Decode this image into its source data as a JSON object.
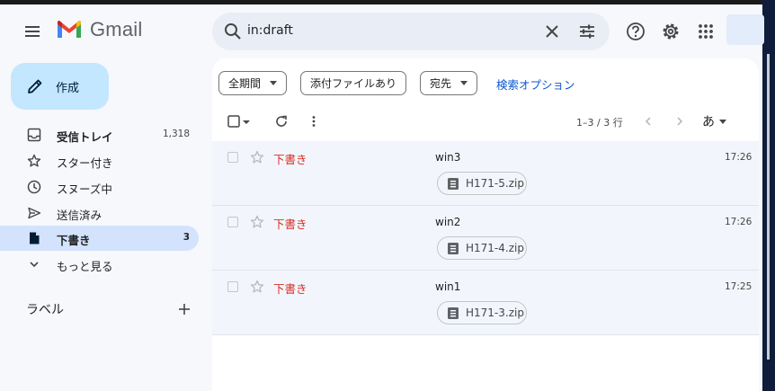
{
  "app": {
    "name": "Gmail"
  },
  "search": {
    "query": "in:draft"
  },
  "compose": {
    "label": "作成"
  },
  "nav": [
    {
      "label": "受信トレイ",
      "count": "1,318",
      "icon": "inbox-icon",
      "bold": true
    },
    {
      "label": "スター付き",
      "count": "",
      "icon": "star-icon"
    },
    {
      "label": "スヌーズ中",
      "count": "",
      "icon": "clock-icon"
    },
    {
      "label": "送信済み",
      "count": "",
      "icon": "send-icon"
    },
    {
      "label": "下書き",
      "count": "3",
      "icon": "draft-icon",
      "bold": true,
      "active": true
    },
    {
      "label": "もっと見る",
      "count": "",
      "icon": "chevron-down-icon"
    }
  ],
  "labels": {
    "title": "ラベル"
  },
  "filters": {
    "date": "全期間",
    "attachment": "添付ファイルあり",
    "to": "宛先",
    "advanced": "検索オプション"
  },
  "toolbar": {
    "pagination": "1–3 / 3 行",
    "input_lang": "あ"
  },
  "emails": [
    {
      "sender": "下書き",
      "subject": "win3",
      "attachment": "H171-5.zip",
      "time": "17:26"
    },
    {
      "sender": "下書き",
      "subject": "win2",
      "attachment": "H171-4.zip",
      "time": "17:26"
    },
    {
      "sender": "下書き",
      "subject": "win1",
      "attachment": "H171-3.zip",
      "time": "17:25"
    }
  ],
  "colors": {
    "accent": "#0b57d0",
    "draft_red": "#d93025",
    "compose_bg": "#c2e7ff",
    "active_nav": "#d3e3fd"
  }
}
